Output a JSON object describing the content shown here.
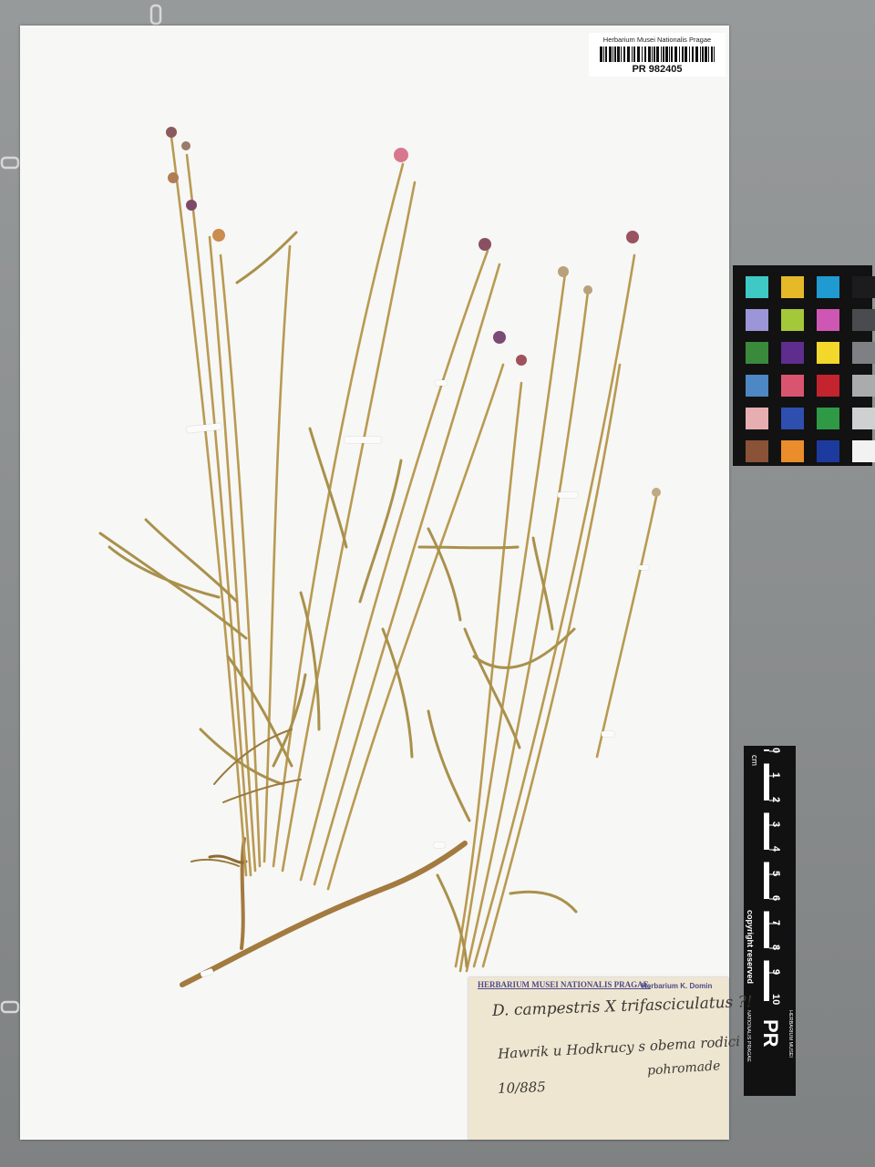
{
  "barcode_label": {
    "institution": "Herbarium Musei Nationalis Pragae",
    "catalog_number": "PR 982405"
  },
  "herbarium_label": {
    "stamp": "HERBARIUM MUSEI NATIONALIS PRAGAE.",
    "collection_stamp": "Herbarium K. Domin",
    "taxon": "D. campestris X trifasciculatus ?!",
    "locality_line1": "Hawrik u Hodkrucy s obema rodici",
    "locality_line2": "pohromade",
    "date": "10/885"
  },
  "scale_bar": {
    "unit": "cm",
    "ticks": [
      "0",
      "1",
      "2",
      "3",
      "4",
      "5",
      "6",
      "7",
      "8",
      "9",
      "10"
    ],
    "copyright": "copyright reserved",
    "logo_lines": [
      "HERBARIUM MUSEI",
      "PR",
      "NATIONALIS PRAGAE"
    ]
  },
  "color_chart": {
    "patches": [
      "#3fc9c4",
      "#e6b928",
      "#1f9bd2",
      "#1c1c1e",
      "#9c95d8",
      "#a4c83a",
      "#cf57b4",
      "#4a4b4e",
      "#3a8a3c",
      "#5e2d8e",
      "#f3d72a",
      "#7e8083",
      "#4d87c4",
      "#d9556f",
      "#c4242e",
      "#a9abad",
      "#e6aeb0",
      "#2e4fb0",
      "#2e9a45",
      "#cfd0d1",
      "#8a5237",
      "#ea8d2a",
      "#1d3a9e",
      "#f2f2f2"
    ]
  }
}
